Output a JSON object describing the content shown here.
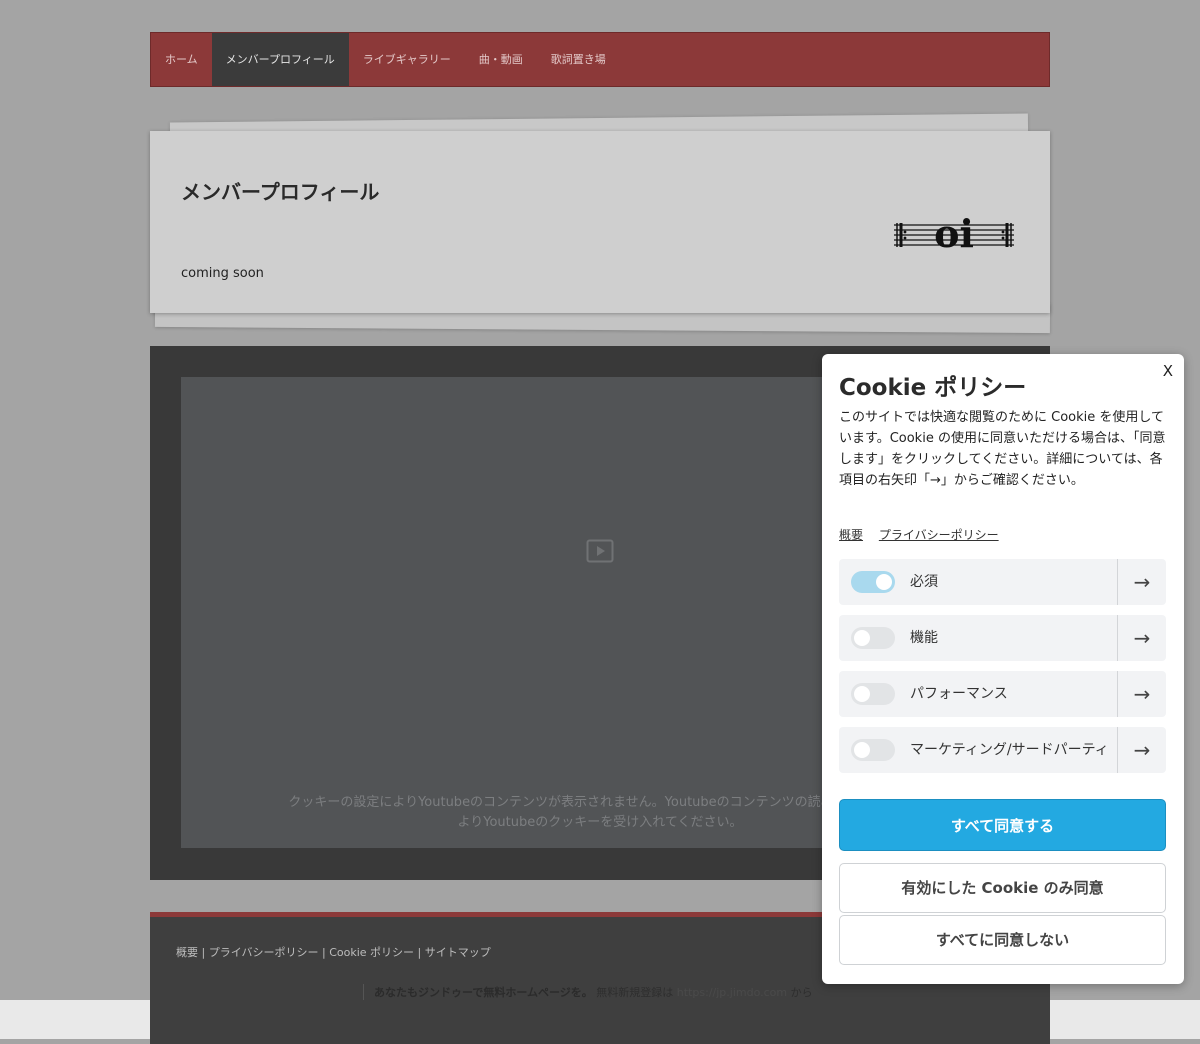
{
  "nav": {
    "items": [
      {
        "label": "ホーム"
      },
      {
        "label": "メンバープロフィール",
        "active": true
      },
      {
        "label": "ライブギャラリー"
      },
      {
        "label": "曲・動画"
      },
      {
        "label": "歌詞置き場"
      }
    ]
  },
  "header": {
    "title": "メンバープロフィール",
    "text": "coming soon",
    "logo_text": "oi"
  },
  "video": {
    "message_line1": "クッキーの設定によりYoutubeのコンテンツが表示されません。Youtubeのコンテンツの読み込みと表示を",
    "message_line2": "よりYoutubeのクッキーを受け入れてください。",
    "icon": "play-icon"
  },
  "footer": {
    "links": [
      "概要",
      "プライバシーポリシー",
      "Cookie ポリシー",
      "サイトマップ"
    ],
    "separator": " | ",
    "jimdo_bold": "あなたもジンドゥーで無料ホームページを。",
    "jimdo_text": " 無料新規登録は ",
    "jimdo_url": "https://jp.jimdo.com",
    "jimdo_tail": " から"
  },
  "cookie_dialog": {
    "close_label": "X",
    "title": "Cookie ポリシー",
    "body": "このサイトでは快適な閲覧のために Cookie を使用しています。Cookie の使用に同意いただける場合は、「同意します」をクリックしてください。詳細については、各項目の右矢印「→」からご確認ください。",
    "links": [
      {
        "label": "概要"
      },
      {
        "label": "プライバシーポリシー"
      }
    ],
    "categories": [
      {
        "label": "必須",
        "enabled": true
      },
      {
        "label": "機能",
        "enabled": false
      },
      {
        "label": "パフォーマンス",
        "enabled": false
      },
      {
        "label": "マーケティング/サードパーティ",
        "enabled": false
      }
    ],
    "arrow": "→",
    "accept_all": "すべて同意する",
    "accept_selected": "有効にした Cookie のみ同意",
    "reject_all": "すべてに同意しない"
  },
  "colors": {
    "nav_bg": "#8c3939",
    "primary_button": "#23a9e1",
    "toggle_on": "#a9d9ee"
  }
}
